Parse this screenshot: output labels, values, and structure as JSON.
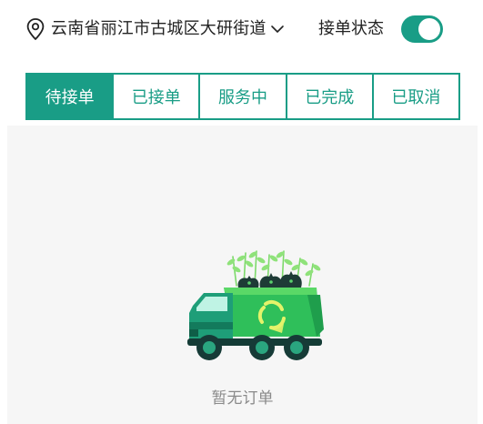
{
  "header": {
    "location_text": "云南省丽江市古城区大研街道",
    "location_icon": "location-pin-icon",
    "dropdown_icon": "chevron-down-icon",
    "status_label": "接单状态",
    "status_toggle_on": true
  },
  "tabs": [
    {
      "label": "待接单",
      "active": true
    },
    {
      "label": "已接单",
      "active": false
    },
    {
      "label": "服务中",
      "active": false
    },
    {
      "label": "已完成",
      "active": false
    },
    {
      "label": "已取消",
      "active": false
    }
  ],
  "empty_state": {
    "message": "暂无订单",
    "illustration": "garbage-truck-illustration"
  },
  "colors": {
    "accent": "#199d86",
    "content_bg": "#f6f6f6",
    "empty_text": "#8a8a8a"
  }
}
